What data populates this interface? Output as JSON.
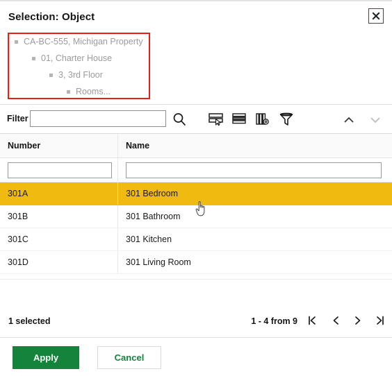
{
  "dialog": {
    "title": "Selection: Object",
    "close_icon": "close-icon"
  },
  "breadcrumb": {
    "items": [
      {
        "label": "CA-BC-555, Michigan Property",
        "level": 0
      },
      {
        "label": "01, Charter House",
        "level": 1
      },
      {
        "label": "3, 3rd Floor",
        "level": 2
      },
      {
        "label": "Rooms...",
        "level": 3
      }
    ],
    "highlight_color": "#ec1c18"
  },
  "toolbar": {
    "filter_label": "Filter",
    "filter_value": "",
    "filter_placeholder": "",
    "icons": [
      {
        "name": "search-icon",
        "title": "Search"
      },
      {
        "name": "select-rows-icon",
        "title": "Select rows"
      },
      {
        "name": "row-layout-icon",
        "title": "Row layout"
      },
      {
        "name": "column-settings-icon",
        "title": "Column settings"
      },
      {
        "name": "funnel-filter-icon",
        "title": "Filter"
      }
    ],
    "collapse_up_icon": "chevron-up-icon",
    "collapse_down_icon": "chevron-down-icon"
  },
  "table": {
    "columns": [
      {
        "key": "number",
        "label": "Number",
        "filter_value": ""
      },
      {
        "key": "name",
        "label": "Name",
        "filter_value": ""
      }
    ],
    "rows": [
      {
        "number": "301A",
        "name": "301 Bedroom",
        "selected": true
      },
      {
        "number": "301B",
        "name": "301 Bathroom",
        "selected": false
      },
      {
        "number": "301C",
        "name": "301 Kitchen",
        "selected": false
      },
      {
        "number": "301D",
        "name": "301 Living Room",
        "selected": false
      }
    ],
    "selected_row_color": "#efbb10"
  },
  "status": {
    "selected_text": "1 selected",
    "page_range": "1 - 4 from 9",
    "pagination": {
      "first_icon": "first-page-icon",
      "prev_icon": "previous-page-icon",
      "next_icon": "next-page-icon",
      "last_icon": "last-page-icon"
    }
  },
  "actions": {
    "apply_label": "Apply",
    "cancel_label": "Cancel",
    "apply_color": "#14833b",
    "cancel_color": "#14833b"
  },
  "cursor": {
    "type": "pointing-hand"
  }
}
